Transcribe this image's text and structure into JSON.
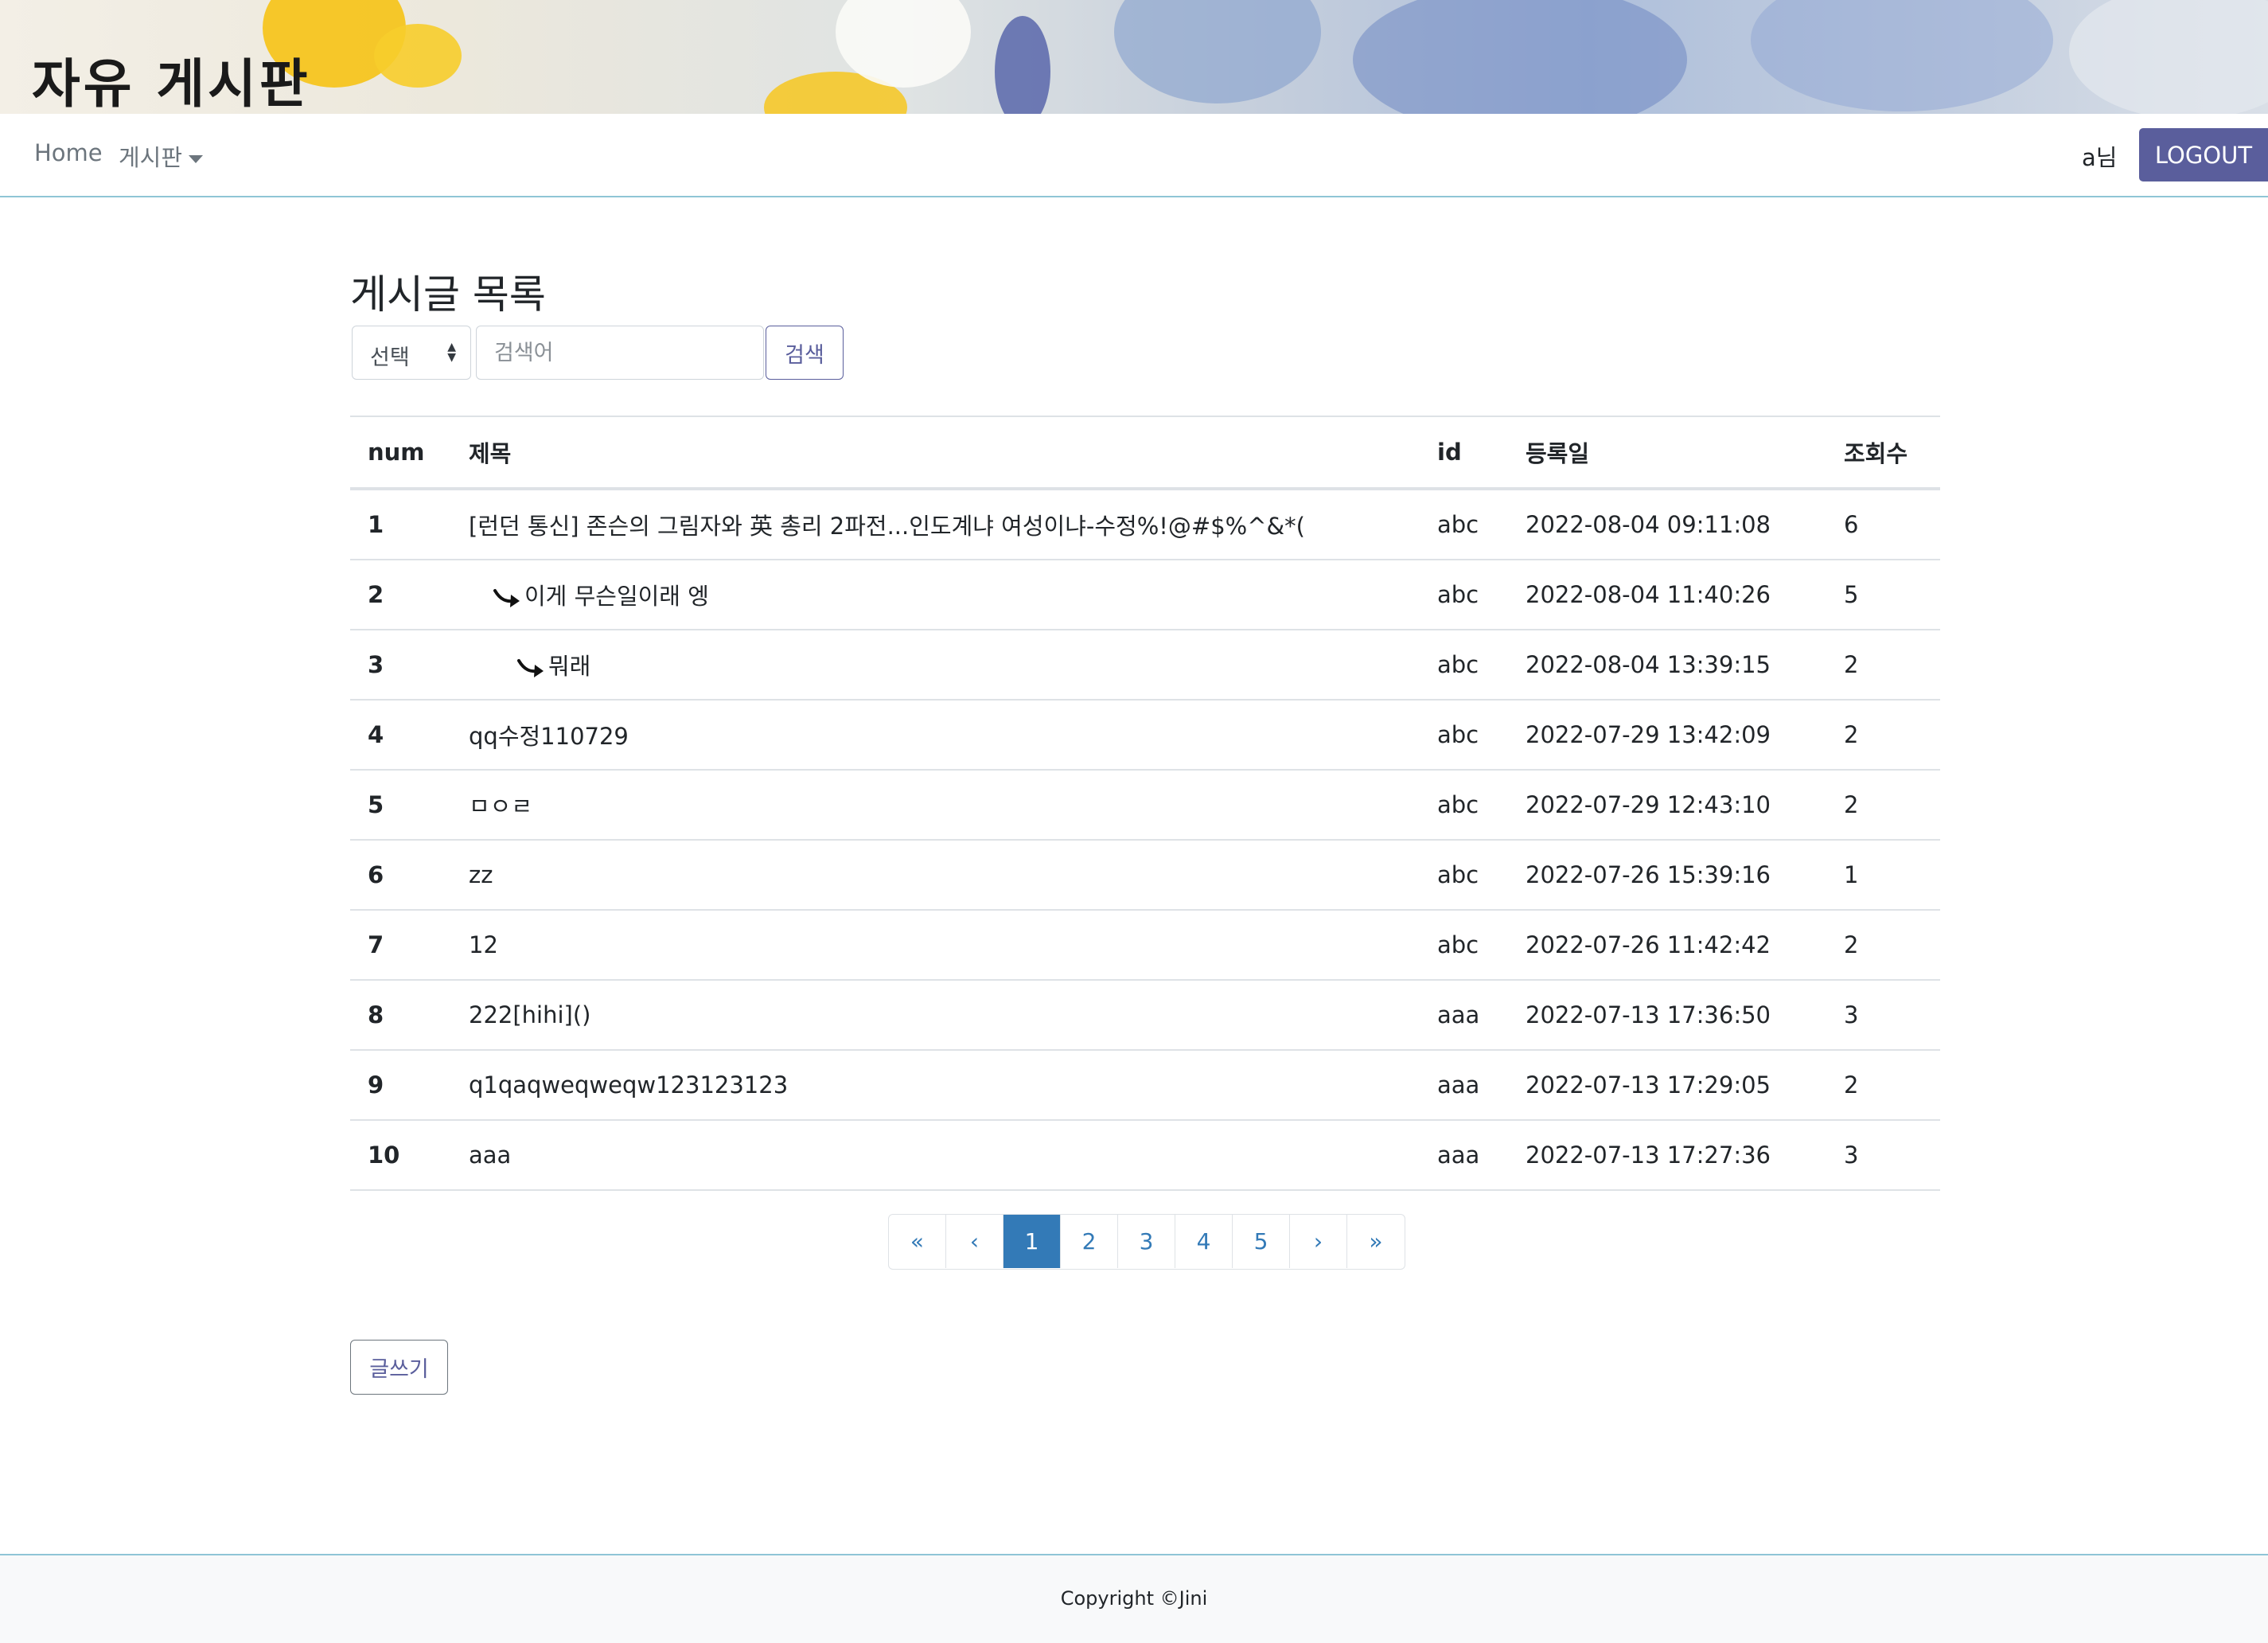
{
  "banner": {
    "title": "자유 게시판"
  },
  "navbar": {
    "home_label": "Home",
    "board_label": "게시판",
    "user_name": "a님",
    "logout_label": "LOGOUT"
  },
  "page": {
    "title": "게시글 목록"
  },
  "search": {
    "select_value": "선택",
    "input_placeholder": "검색어",
    "button_label": "검색"
  },
  "table": {
    "columns": [
      "num",
      "제목",
      "id",
      "등록일",
      "조회수"
    ],
    "rows": [
      {
        "num": "1",
        "title": "[런던 통신] 존슨의 그림자와 英 총리 2파전...인도계냐 여성이냐-수정%!@#$%^&*(",
        "depth": 0,
        "id": "abc",
        "date": "2022-08-04 09:11:08",
        "views": "6"
      },
      {
        "num": "2",
        "title": "이게 무슨일이래 엥",
        "depth": 1,
        "id": "abc",
        "date": "2022-08-04 11:40:26",
        "views": "5"
      },
      {
        "num": "3",
        "title": "뭐래",
        "depth": 2,
        "id": "abc",
        "date": "2022-08-04 13:39:15",
        "views": "2"
      },
      {
        "num": "4",
        "title": "qq수정110729",
        "depth": 0,
        "id": "abc",
        "date": "2022-07-29 13:42:09",
        "views": "2"
      },
      {
        "num": "5",
        "title": "ㅁㅇㄹ",
        "depth": 0,
        "id": "abc",
        "date": "2022-07-29 12:43:10",
        "views": "2"
      },
      {
        "num": "6",
        "title": "zz",
        "depth": 0,
        "id": "abc",
        "date": "2022-07-26 15:39:16",
        "views": "1"
      },
      {
        "num": "7",
        "title": "12",
        "depth": 0,
        "id": "abc",
        "date": "2022-07-26 11:42:42",
        "views": "2"
      },
      {
        "num": "8",
        "title": "222[hihi]()",
        "depth": 0,
        "id": "aaa",
        "date": "2022-07-13 17:36:50",
        "views": "3"
      },
      {
        "num": "9",
        "title": "q1qaqweqweqw123123123",
        "depth": 0,
        "id": "aaa",
        "date": "2022-07-13 17:29:05",
        "views": "2"
      },
      {
        "num": "10",
        "title": "aaa",
        "depth": 0,
        "id": "aaa",
        "date": "2022-07-13 17:27:36",
        "views": "3"
      }
    ]
  },
  "pagination": {
    "first": "«",
    "prev": "‹",
    "pages": [
      "1",
      "2",
      "3",
      "4",
      "5"
    ],
    "active": "1",
    "next": "›",
    "last": "»"
  },
  "write_button": "글쓰기",
  "footer": {
    "copyright": "Copyright ©Jini"
  },
  "colors": {
    "accent": "#5a5e9c",
    "page_active": "#337ab7",
    "divider": "#8fc5d6"
  }
}
